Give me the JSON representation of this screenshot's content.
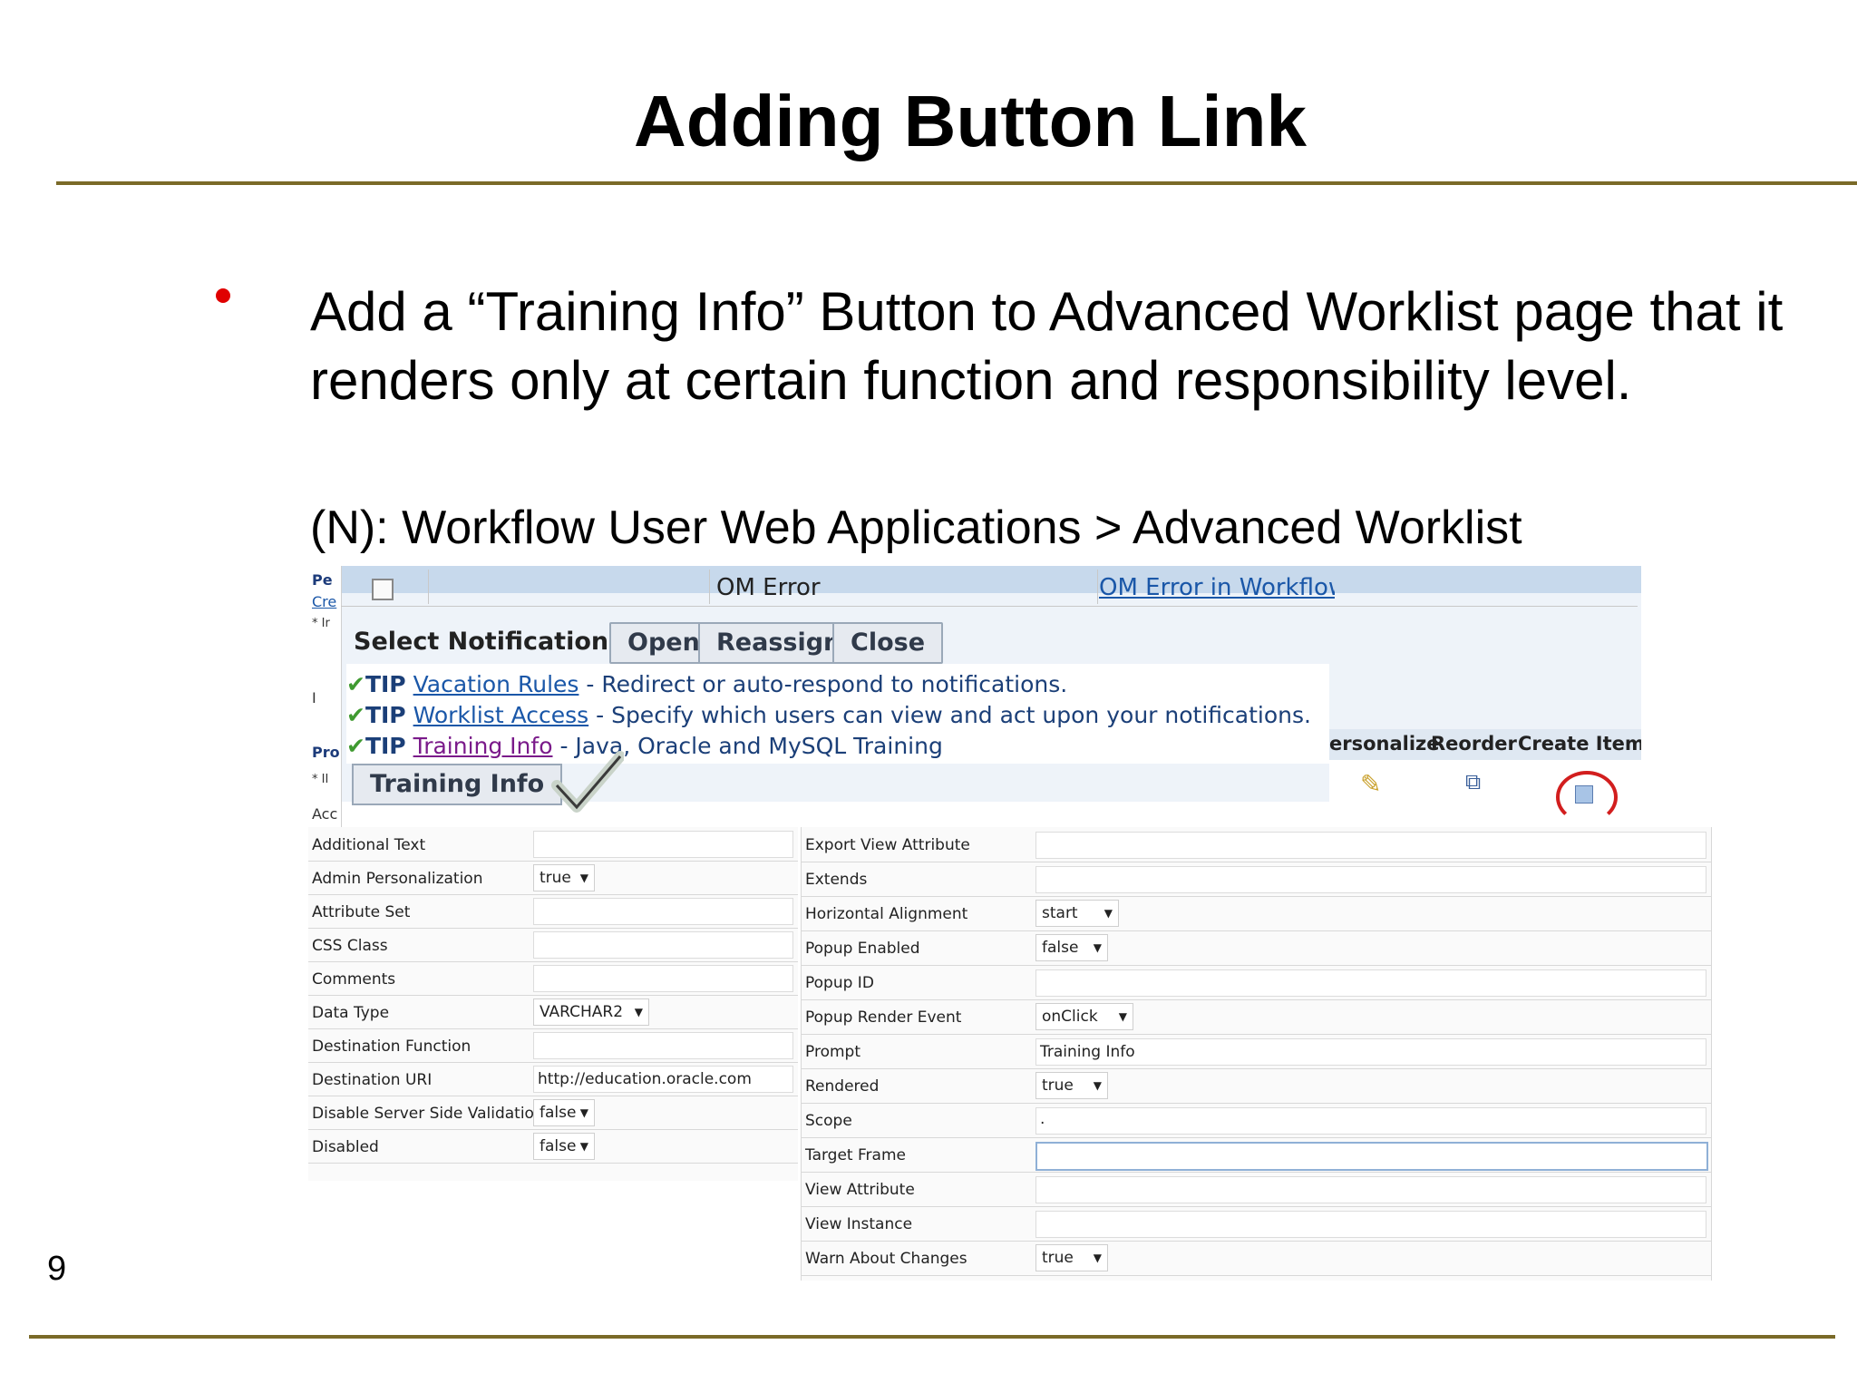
{
  "slide": {
    "title": "Adding Button Link",
    "bullet": "Add a “Training Info” Button to Advanced Worklist page that it renders only at certain function and responsibility level.",
    "nav_path": "(N): Workflow User Web Applications > Advanced Worklist",
    "page_number": "9",
    "colors": {
      "rule": "#7a6a28",
      "bullet": "#e00000"
    }
  },
  "screenshot": {
    "left_strip": {
      "pe": "Pe",
      "cre": "Cre",
      "ir": "* Ir",
      "ii": "I",
      "pro": "Pro",
      "iI": "* II",
      "acc": "Acc"
    },
    "om_row": {
      "error_text": "OM Error",
      "error_link": "OM Error in Workflow"
    },
    "select_notifications": {
      "label": "Select Notifications:",
      "buttons": [
        "Open",
        "Reassign",
        "Close"
      ]
    },
    "tips": [
      {
        "prefix": "TIP",
        "link": "Vacation Rules",
        "text": " - Redirect or auto-respond to notifications."
      },
      {
        "prefix": "TIP",
        "link": "Worklist Access",
        "text": " - Specify which users can view and act upon your notifications."
      },
      {
        "prefix": "TIP",
        "link": "Training Info",
        "text": " - Java, Oracle and MySQL Training"
      }
    ],
    "training_button": "Training Info",
    "grid_headers": [
      "ersonalize",
      "Reorder",
      "Create Item"
    ],
    "left_properties": [
      {
        "label": "Additional Text",
        "value": "",
        "type": "text"
      },
      {
        "label": "Admin Personalization",
        "value": "true",
        "type": "select"
      },
      {
        "label": "Attribute Set",
        "value": "",
        "type": "text"
      },
      {
        "label": "CSS Class",
        "value": "",
        "type": "text"
      },
      {
        "label": "Comments",
        "value": "",
        "type": "text"
      },
      {
        "label": "Data Type",
        "value": "VARCHAR2",
        "type": "select"
      },
      {
        "label": "Destination Function",
        "value": "",
        "type": "text"
      },
      {
        "label": "Destination URI",
        "value": "http://education.oracle.com",
        "type": "text"
      },
      {
        "label": "Disable Server Side Validation",
        "value": "false",
        "type": "select"
      },
      {
        "label": "Disabled",
        "value": "false",
        "type": "select"
      }
    ],
    "right_properties": [
      {
        "label": "Export View Attribute",
        "value": "",
        "type": "text"
      },
      {
        "label": "Extends",
        "value": "",
        "type": "text"
      },
      {
        "label": "Horizontal Alignment",
        "value": "start",
        "type": "select"
      },
      {
        "label": "Popup Enabled",
        "value": "false",
        "type": "select"
      },
      {
        "label": "Popup ID",
        "value": "",
        "type": "text"
      },
      {
        "label": "Popup Render Event",
        "value": "onClick",
        "type": "select"
      },
      {
        "label": "Prompt",
        "value": "Training Info",
        "type": "text"
      },
      {
        "label": "Rendered",
        "value": "true",
        "type": "select"
      },
      {
        "label": "Scope",
        "value": ".",
        "type": "text"
      },
      {
        "label": "Target Frame",
        "value": "",
        "type": "text"
      },
      {
        "label": "View Attribute",
        "value": "",
        "type": "text"
      },
      {
        "label": "View Instance",
        "value": "",
        "type": "text"
      },
      {
        "label": "Warn About Changes",
        "value": "true",
        "type": "select"
      }
    ]
  }
}
